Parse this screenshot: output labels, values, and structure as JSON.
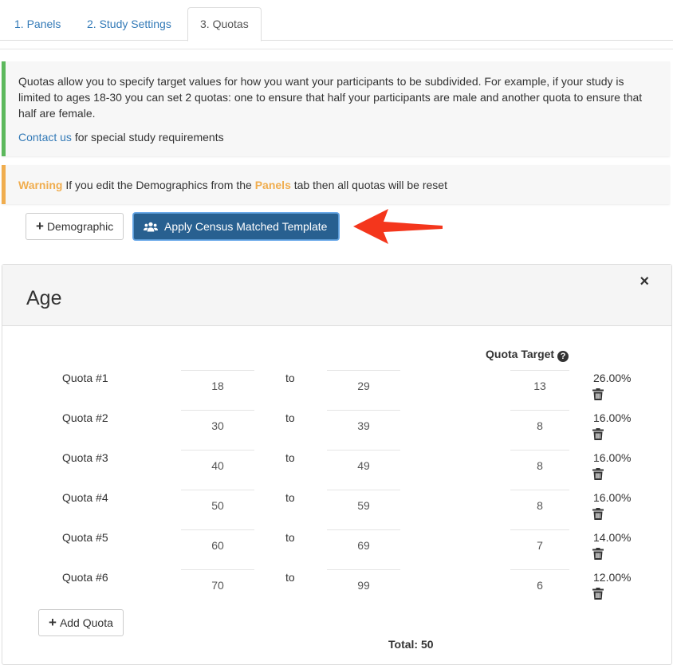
{
  "tabs": [
    {
      "label": "1. Panels"
    },
    {
      "label": "2. Study Settings"
    },
    {
      "label": "3. Quotas"
    }
  ],
  "info": {
    "text": "Quotas allow you to specify target values for how you want your participants to be subdivided. For example, if your study is limited to ages 18-30 you can set 2 quotas: one to ensure that half your participants are male and another quota to ensure that half are female.",
    "contact_link": "Contact us",
    "contact_rest": " for special study requirements"
  },
  "warning": {
    "label": "Warning",
    "text_before": " If you edit the Demographics from the ",
    "panels": "Panels",
    "text_after": " tab then all quotas will be reset"
  },
  "buttons": {
    "demographic": "Demographic",
    "census": "Apply Census Matched Template",
    "add_quota": "Add Quota"
  },
  "panel": {
    "title": "Age",
    "close": "×",
    "quota_target_label": "Quota Target",
    "to_label": "to",
    "total": "Total: 50"
  },
  "quotas": [
    {
      "label": "Quota #1",
      "from": "18",
      "to": "29",
      "target": "13",
      "pct": "26.00%"
    },
    {
      "label": "Quota #2",
      "from": "30",
      "to": "39",
      "target": "8",
      "pct": "16.00%"
    },
    {
      "label": "Quota #3",
      "from": "40",
      "to": "49",
      "target": "8",
      "pct": "16.00%"
    },
    {
      "label": "Quota #4",
      "from": "50",
      "to": "59",
      "target": "8",
      "pct": "16.00%"
    },
    {
      "label": "Quota #5",
      "from": "60",
      "to": "69",
      "target": "7",
      "pct": "14.00%"
    },
    {
      "label": "Quota #6",
      "from": "70",
      "to": "99",
      "target": "6",
      "pct": "12.00%"
    }
  ],
  "colors": {
    "link": "#337ab7",
    "primary": "#286090",
    "success_border": "#5cb85c",
    "warning": "#f0ad4e",
    "arrow": "#f4361c"
  },
  "icons": {
    "users": "users-icon",
    "plus": "plus-icon",
    "trash": "trash-icon",
    "help": "question-circle-icon",
    "arrow": "red-arrow-icon"
  }
}
